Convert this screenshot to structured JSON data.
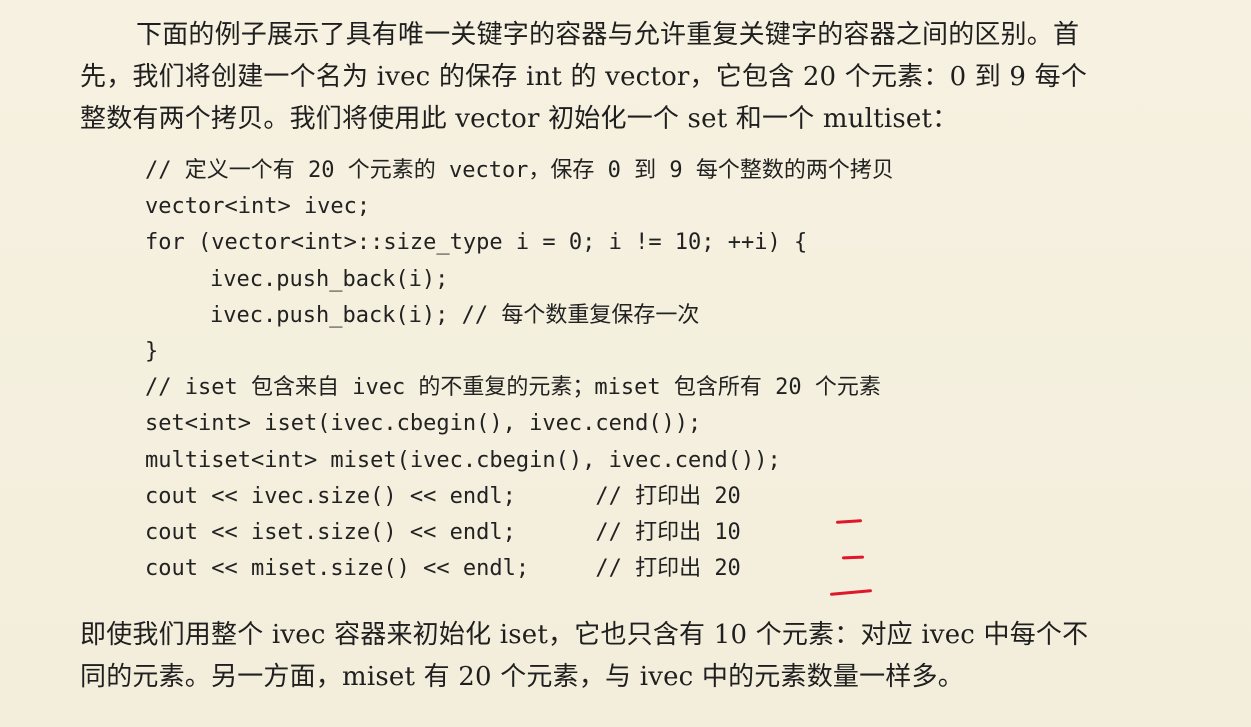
{
  "intro": {
    "line1": "下面的例子展示了具有唯一关键字的容器与允许重复关键字的容器之间的区别。首",
    "line2": "先，我们将创建一个名为 ivec 的保存 int 的 vector，它包含 20 个元素：0 到 9 每个",
    "line3": "整数有两个拷贝。我们将使用此 vector 初始化一个 set 和一个 multiset："
  },
  "code": {
    "lines": [
      "// 定义一个有 20 个元素的 vector，保存 0 到 9 每个整数的两个拷贝",
      "vector<int> ivec;",
      "for (vector<int>::size_type i = 0; i != 10; ++i) {",
      "ivec.push_back(i);",
      "ivec.push_back(i); // 每个数重复保存一次",
      "}",
      "// iset 包含来自 ivec 的不重复的元素；miset 包含所有 20 个元素",
      "set<int> iset(ivec.cbegin(), ivec.cend());",
      "multiset<int> miset(ivec.cbegin(), ivec.cend());",
      "cout << ivec.size() << endl;      // 打印出 20",
      "cout << iset.size() << endl;      // 打印出 10",
      "cout << miset.size() << endl;     // 打印出 20"
    ]
  },
  "outro": {
    "line1": "即使我们用整个 ivec 容器来初始化 iset，它也只含有 10 个元素：对应 ivec 中每个不",
    "line2": "同的元素。另一方面，miset 有 20 个元素，与 ivec 中的元素数量一样多。"
  },
  "annotations": {
    "color": "#e0162b"
  }
}
